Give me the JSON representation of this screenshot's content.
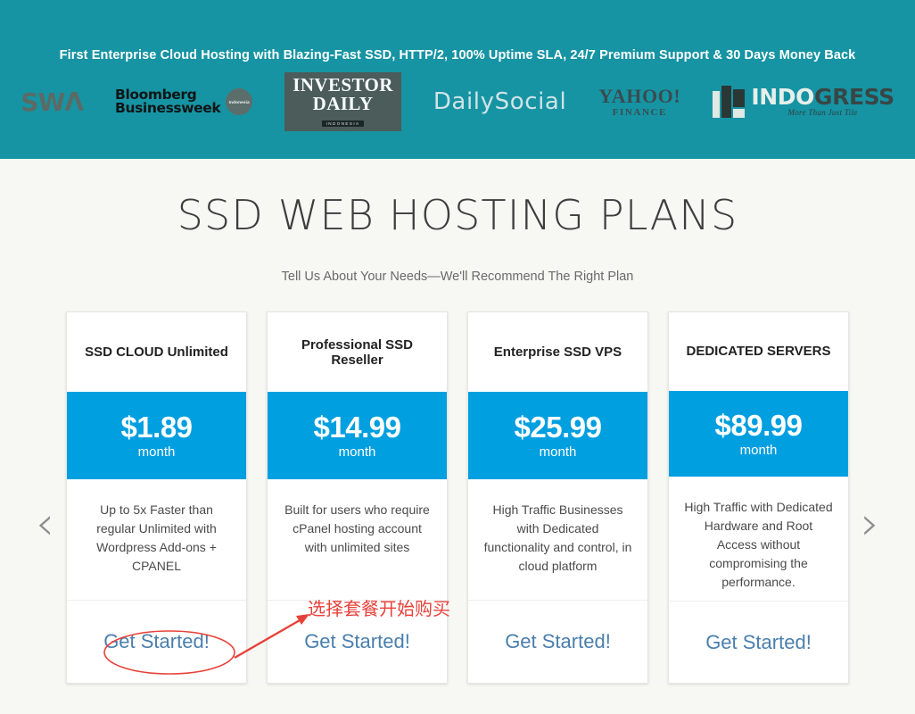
{
  "header": {
    "tagline": "First Enterprise Cloud Hosting with Blazing-Fast SSD, HTTP/2, 100% Uptime SLA, 24/7 Premium Support & 30 Days Money Back",
    "background_color": "#1694a4",
    "logos": [
      {
        "name": "swa-logo",
        "text": "SWΛ"
      },
      {
        "name": "bloomberg-businessweek-logo",
        "line1": "Bloomberg",
        "line2": "Businessweek",
        "badge": "Indonesia"
      },
      {
        "name": "investor-daily-logo",
        "main": "INVESTOR DAILY",
        "sub": "INDONESIA"
      },
      {
        "name": "dailysocial-logo",
        "text": "DailySocial"
      },
      {
        "name": "yahoo-finance-logo",
        "main": "YAHOO!",
        "sub": "FINANCE"
      },
      {
        "name": "indogress-logo",
        "main_a": "INDO",
        "main_b": "GRESS",
        "sub": "More Than Just Tile"
      }
    ]
  },
  "main": {
    "title": "SSD WEB HOSTING PLANS",
    "subtitle": "Tell Us About Your Needs—We'll Recommend The Right Plan",
    "background_color": "#f7f8f3",
    "accent_color": "#009fdf",
    "link_color": "#4a7fad",
    "carousel": {
      "prev_label": "‹",
      "next_label": "›"
    },
    "plans": [
      {
        "title": "SSD CLOUD Unlimited",
        "price": "$1.89",
        "period": "month",
        "description": "Up to 5x Faster than regular Unlimited with Wordpress Add-ons + CPANEL",
        "cta": "Get Started!",
        "highlighted": true
      },
      {
        "title": "Professional SSD Reseller",
        "price": "$14.99",
        "period": "month",
        "description": "Built for users who require cPanel hosting account with unlimited sites",
        "cta": "Get Started!",
        "highlighted": false
      },
      {
        "title": "Enterprise SSD VPS",
        "price": "$25.99",
        "period": "month",
        "description": "High Traffic Businesses with Dedicated functionality and control, in cloud platform",
        "cta": "Get Started!",
        "highlighted": false
      },
      {
        "title": "DEDICATED SERVERS",
        "price": "$89.99",
        "period": "month",
        "description": "High Traffic with Dedicated Hardware and Root Access without compromising the performance.",
        "cta": "Get Started!",
        "highlighted": false
      }
    ]
  },
  "annotation": {
    "text": "选择套餐开始购买",
    "color": "#e8413a"
  }
}
